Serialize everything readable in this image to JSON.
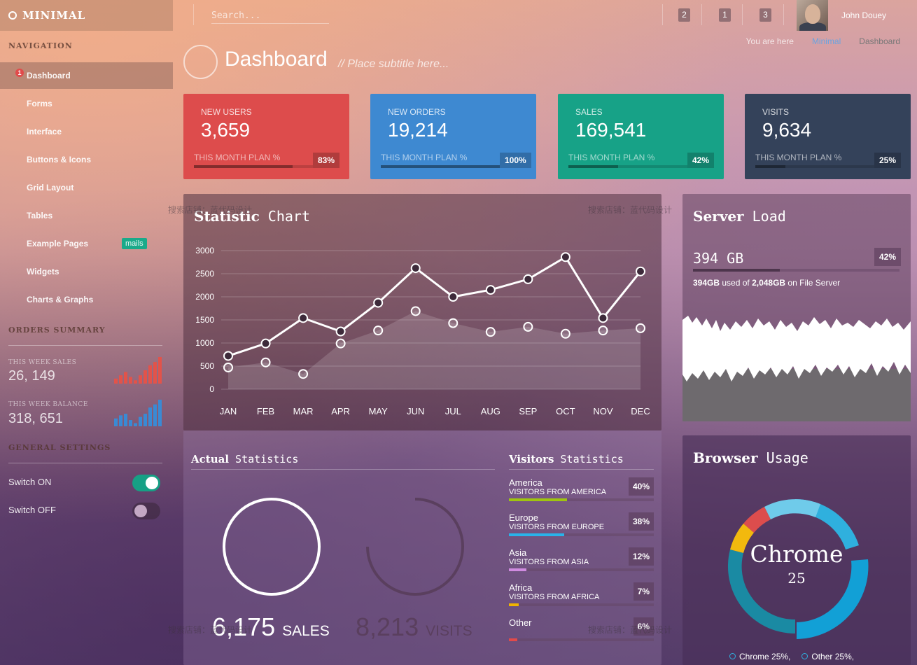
{
  "app": {
    "name": "MINIMAL"
  },
  "search": {
    "placeholder": "Search..."
  },
  "notifications": [
    "2",
    "1",
    "3"
  ],
  "user": {
    "name": "John Douey"
  },
  "breadcrumb": {
    "label": "You are here",
    "items": [
      "Minimal",
      "Dashboard"
    ]
  },
  "sidebar": {
    "nav_heading": "NAVIGATION",
    "items": [
      {
        "label": "Dashboard",
        "badge": "1"
      },
      {
        "label": "Forms"
      },
      {
        "label": "Interface"
      },
      {
        "label": "Buttons & Icons"
      },
      {
        "label": "Grid Layout"
      },
      {
        "label": "Tables"
      },
      {
        "label": "Example Pages",
        "tag": "mails"
      },
      {
        "label": "Widgets"
      },
      {
        "label": "Charts & Graphs"
      }
    ],
    "orders_heading": "ORDERS SUMMARY",
    "week_sales_label": "THIS WEEK SALES",
    "week_sales_value": "26, 149",
    "week_sales_bars": [
      3,
      5,
      7,
      4,
      2,
      5,
      8,
      11,
      13,
      16
    ],
    "week_balance_label": "THIS WEEK BALANCE",
    "week_balance_value": "318, 651",
    "week_balance_bars": [
      5,
      7,
      8,
      4,
      2,
      6,
      8,
      12,
      14,
      17
    ],
    "settings_heading": "GENERAL SETTINGS",
    "switch_on_label": "Switch ON",
    "switch_off_label": "Switch OFF",
    "switch_on_state": true,
    "switch_off_state": false
  },
  "page": {
    "title": "Dashboard",
    "subtitle": "// Place subtitle here..."
  },
  "cards": [
    {
      "label": "NEW USERS",
      "value": "3,659",
      "plan_label": "THIS MONTH PLAN %",
      "percent": "83%",
      "progress": 0.83,
      "color": "#dd4c4c"
    },
    {
      "label": "NEW ORDERS",
      "value": "19,214",
      "plan_label": "THIS MONTH PLAN %",
      "percent": "100%",
      "progress": 1.0,
      "color": "#3e89d1"
    },
    {
      "label": "SALES",
      "value": "169,541",
      "plan_label": "THIS MONTH PLAN %",
      "percent": "42%",
      "progress": 0.42,
      "color": "#17a287"
    },
    {
      "label": "VISITS",
      "value": "9,634",
      "plan_label": "THIS MONTH PLAN %",
      "percent": "25%",
      "progress": 0.25,
      "color": "#34425a"
    }
  ],
  "statistic_chart": {
    "title_bold": "Statistic",
    "title_rest": " Chart"
  },
  "chart_data": {
    "type": "line",
    "categories": [
      "JAN",
      "FEB",
      "MAR",
      "APR",
      "MAY",
      "JUN",
      "JUL",
      "AUG",
      "SEP",
      "OCT",
      "NOV",
      "DEC"
    ],
    "series": [
      {
        "values": [
          720,
          990,
          1540,
          1250,
          1870,
          2620,
          2000,
          2150,
          2380,
          2860,
          1540,
          2550
        ]
      },
      {
        "values": [
          470,
          580,
          330,
          990,
          1270,
          1690,
          1430,
          1240,
          1350,
          1200,
          1270,
          1320
        ]
      }
    ],
    "yticks": [
      0,
      500,
      1000,
      1500,
      2000,
      2500,
      3000
    ],
    "ylim": [
      0,
      3000
    ]
  },
  "actual_stats": {
    "title_bold": "Actual",
    "title_rest": " Statistics",
    "sales_value": "6,175",
    "sales_label": "SALES",
    "visits_value": "8,213",
    "visits_label": "VISITS"
  },
  "visitors_stats": {
    "title_bold": "Visitors",
    "title_rest": " Statistics",
    "items": [
      {
        "name": "America",
        "desc": "VISITORS FROM AMERICA",
        "percent": "40%",
        "progress": 0.4,
        "color": "#9fc40f"
      },
      {
        "name": "Europe",
        "desc": "VISITORS FROM EUROPE",
        "percent": "38%",
        "progress": 0.38,
        "color": "#29b3ea"
      },
      {
        "name": "Asia",
        "desc": "VISITORS FROM ASIA",
        "percent": "12%",
        "progress": 0.12,
        "color": "#d08be0"
      },
      {
        "name": "Africa",
        "desc": "VISITORS FROM AFRICA",
        "percent": "7%",
        "progress": 0.07,
        "color": "#f0b400"
      },
      {
        "name": "Other",
        "desc": "",
        "percent": "6%",
        "progress": 0.06,
        "color": "#e24a4a"
      }
    ]
  },
  "server_load": {
    "title_bold": "Server",
    "title_rest": " Load",
    "value": "394 GB",
    "percent": "42%",
    "progress": 0.42,
    "used": "394GB",
    "total": "2,048GB",
    "text_used": " used of ",
    "text_on": " on File Server"
  },
  "browser_usage": {
    "title_bold": "Browser",
    "title_rest": " Usage",
    "center_label": "Chrome",
    "center_value": "25",
    "legend": [
      {
        "name": "Chrome",
        "value": "25%,"
      },
      {
        "name": "Other",
        "value": "25%,"
      }
    ]
  },
  "watermarks": [
    "搜索店铺：蓝代码设计"
  ]
}
